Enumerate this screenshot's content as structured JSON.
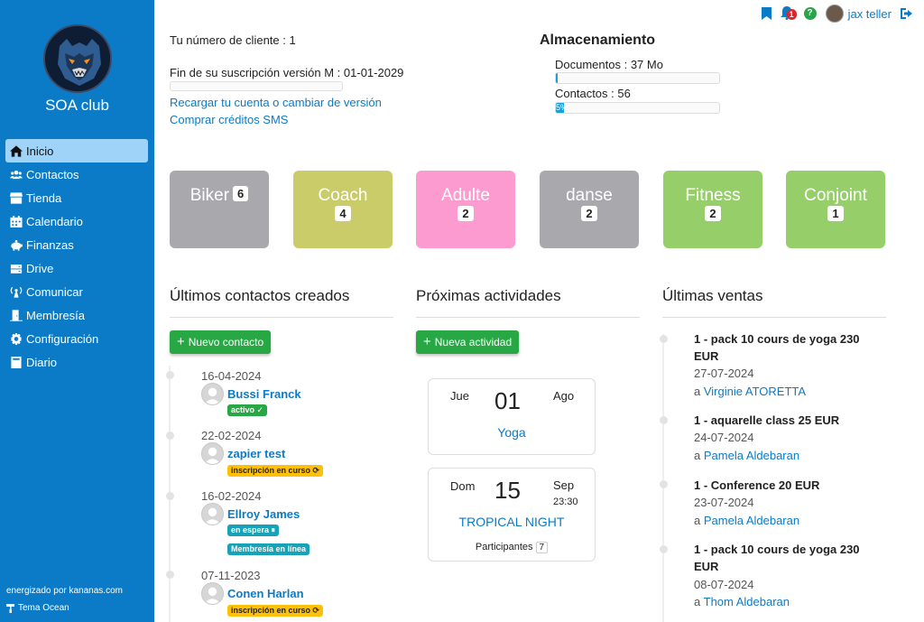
{
  "sidebar": {
    "club_name": "SOA club",
    "items": [
      {
        "label": "Inicio",
        "icon": "home-icon",
        "active": true
      },
      {
        "label": "Contactos",
        "icon": "users-icon"
      },
      {
        "label": "Tienda",
        "icon": "store-icon"
      },
      {
        "label": "Calendario",
        "icon": "calendar-icon"
      },
      {
        "label": "Finanzas",
        "icon": "piggy-bank-icon"
      },
      {
        "label": "Drive",
        "icon": "hard-drive-icon"
      },
      {
        "label": "Comunicar",
        "icon": "broadcast-icon"
      },
      {
        "label": "Membresía",
        "icon": "door-icon"
      },
      {
        "label": "Configuración",
        "icon": "gear-icon"
      },
      {
        "label": "Diario",
        "icon": "book-icon"
      }
    ],
    "powered_by": "energizado por kananas.com",
    "theme": "Tema Ocean"
  },
  "topbar": {
    "notifications_count": "1",
    "help_label": "?",
    "user_name": "jax teller"
  },
  "client": {
    "number_text": "Tu número de cliente : 1",
    "subscription_text": "Fin de su suscripción versión M : 01-01-2029",
    "reload_link": "Recargar tu cuenta o cambiar de versión",
    "sms_link": "Comprar créditos SMS"
  },
  "storage": {
    "title": "Almacenamiento",
    "documents_label": "Documentos : 37 Mo",
    "documents_fraction": 0.01,
    "contacts_label": "Contactos : 56",
    "contacts_fraction": 0.05,
    "contacts_bar_text": "5%"
  },
  "groups": [
    {
      "name": "Biker",
      "count": "6",
      "color": "#a9a8ad"
    },
    {
      "name": "Coach",
      "count": "4",
      "color": "#c9cc68"
    },
    {
      "name": "Adulte",
      "count": "2",
      "color": "#fb9bd0"
    },
    {
      "name": "danse",
      "count": "2",
      "color": "#a9a8ad"
    },
    {
      "name": "Fitness",
      "count": "2",
      "color": "#96cf6a"
    },
    {
      "name": "Conjoint",
      "count": "1",
      "color": "#96cf6a"
    }
  ],
  "contacts_section": {
    "title": "Últimos contactos creados",
    "button": "Nuevo contacto",
    "items": [
      {
        "date": "16-04-2024",
        "name": "Bussi Franck",
        "tags": [
          {
            "text": "activo ✓",
            "style": "green"
          }
        ]
      },
      {
        "date": "22-02-2024",
        "name": "zapier test",
        "tags": [
          {
            "text": "inscripción en curso ⟳",
            "style": "yellow"
          }
        ]
      },
      {
        "date": "16-02-2024",
        "name": "Ellroy James",
        "tags": [
          {
            "text": "en espera ⏸",
            "style": "teal"
          },
          {
            "text": "Membresía en línea",
            "style": "teal"
          }
        ]
      },
      {
        "date": "07-11-2023",
        "name": "Conen Harlan",
        "tags": [
          {
            "text": "inscripción en curso ⟳",
            "style": "yellow"
          }
        ]
      }
    ]
  },
  "activities_section": {
    "title": "Próximas actividades",
    "button": "Nueva actividad",
    "items": [
      {
        "dow": "Jue",
        "day": "01",
        "month": "Ago",
        "name": "Yoga",
        "time": "",
        "participants_label": "",
        "participants": ""
      },
      {
        "dow": "Dom",
        "day": "15",
        "month": "Sep",
        "name": "TROPICAL NIGHT",
        "time": "23:30",
        "participants_label": "Participantes",
        "participants": "7"
      }
    ]
  },
  "sales_section": {
    "title": "Últimas ventas",
    "by_prefix": "a",
    "items": [
      {
        "title": "1 - pack 10 cours de yoga 230 EUR",
        "date": "27-07-2024",
        "buyer": "Virginie ATORETTA"
      },
      {
        "title": "1 - aquarelle class 25 EUR",
        "date": "24-07-2024",
        "buyer": "Pamela Aldebaran"
      },
      {
        "title": "1 - Conference 20 EUR",
        "date": "23-07-2024",
        "buyer": "Pamela Aldebaran"
      },
      {
        "title": "1 - pack 10 cours de yoga 230 EUR",
        "date": "08-07-2024",
        "buyer": "Thom Aldebaran"
      }
    ]
  }
}
